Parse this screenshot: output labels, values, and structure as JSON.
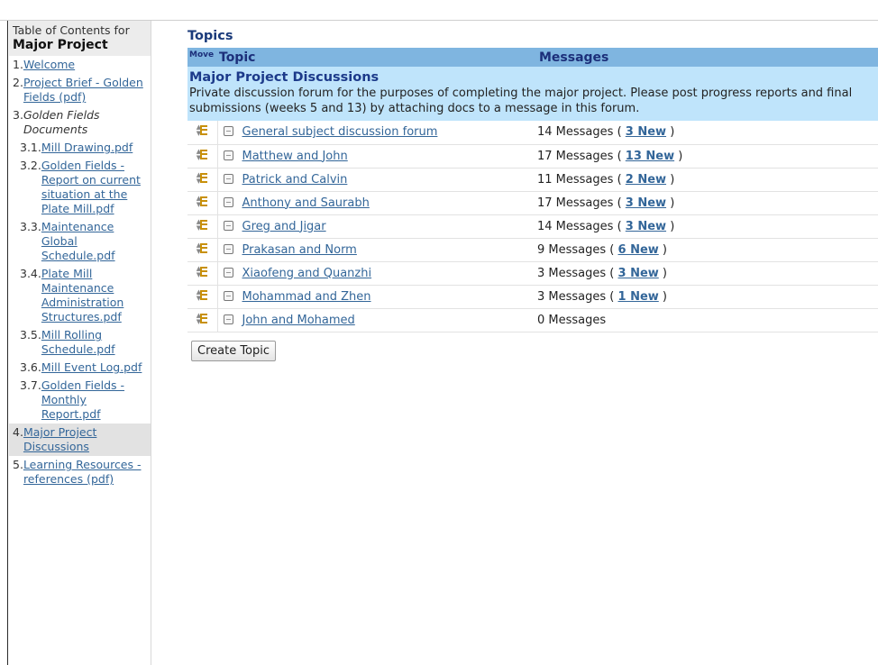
{
  "sidebar": {
    "title": "Table of Contents for",
    "project": "Major Project",
    "items": [
      {
        "num": "1.",
        "label": "Welcome",
        "type": "link"
      },
      {
        "num": "2.",
        "label": "Project Brief - Golden Fields (pdf)",
        "type": "link"
      },
      {
        "num": "3.",
        "label": "Golden Fields Documents",
        "type": "text"
      },
      {
        "num": "3.1.",
        "label": "Mill Drawing.pdf",
        "type": "link"
      },
      {
        "num": "3.2.",
        "label": "Golden Fields - Report on current situation at the Plate Mill.pdf",
        "type": "link"
      },
      {
        "num": "3.3.",
        "label": "Maintenance Global Schedule.pdf",
        "type": "link"
      },
      {
        "num": "3.4.",
        "label": "Plate Mill Maintenance Administration Structures.pdf",
        "type": "link"
      },
      {
        "num": "3.5.",
        "label": "Mill Rolling Schedule.pdf",
        "type": "link"
      },
      {
        "num": "3.6.",
        "label": "Mill Event Log.pdf",
        "type": "link"
      },
      {
        "num": "3.7.",
        "label": "Golden Fields - Monthly Report.pdf",
        "type": "link"
      },
      {
        "num": "4.",
        "label": "Major Project Discussions",
        "type": "link"
      },
      {
        "num": "5.",
        "label": "Learning Resources - references (pdf)",
        "type": "link"
      }
    ]
  },
  "main": {
    "title": "Topics",
    "columns": {
      "move": "Move",
      "topic": "Topic",
      "messages": "Messages"
    },
    "forum": {
      "name": "Major Project Discussions",
      "description": "Private discussion forum for the purposes of completing the major project. Please post progress reports and final submissions (weeks 5 and 13) by attaching docs to a message in this forum."
    },
    "topics": [
      {
        "name": "General subject discussion forum",
        "messages": "14 Messages",
        "new": "3 New"
      },
      {
        "name": "Matthew and John",
        "messages": "17 Messages",
        "new": "13 New"
      },
      {
        "name": "Patrick and Calvin",
        "messages": "11 Messages",
        "new": "2 New"
      },
      {
        "name": "Anthony and Saurabh",
        "messages": "17 Messages",
        "new": "3 New"
      },
      {
        "name": "Greg and Jigar",
        "messages": "14 Messages",
        "new": "3 New"
      },
      {
        "name": "Prakasan and Norm",
        "messages": "9 Messages",
        "new": "6 New"
      },
      {
        "name": "Xiaofeng and Quanzhi",
        "messages": "3 Messages",
        "new": "3 New"
      },
      {
        "name": "Mohammad and Zhen",
        "messages": "3 Messages",
        "new": "1 New"
      },
      {
        "name": "John and Mohamed",
        "messages": "0 Messages",
        "new": null
      }
    ],
    "create_label": "Create Topic"
  }
}
